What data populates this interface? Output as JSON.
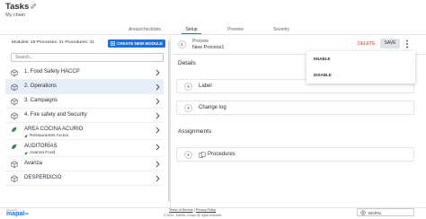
{
  "header": {
    "title": "Tasks",
    "subtitle": "My chain"
  },
  "tabs": [
    {
      "label": "Areas/checklists",
      "active": false
    },
    {
      "label": "Setup",
      "active": true
    },
    {
      "label": "Preview",
      "active": false
    },
    {
      "label": "Severity",
      "active": false
    }
  ],
  "left_panel": {
    "counts": "Modules: 18 Processes: 41 Procedures: 41",
    "new_module_label": "CREATE NEW MODULE",
    "search_placeholder": "Search...",
    "modules": [
      {
        "label": "1. Food Safety HACCP",
        "icon": "box-icon",
        "selected": false
      },
      {
        "label": "2. Operations",
        "icon": "box-icon",
        "selected": true
      },
      {
        "label": "3. Campaigns",
        "icon": "box-icon",
        "selected": false
      },
      {
        "label": "4. Fire safety and Security",
        "icon": "box-icon",
        "selected": false
      },
      {
        "label": "AREA COCINA ACURIO",
        "icon": "leaf-icon",
        "sub": "Restaurantes Acurio",
        "selected": false
      },
      {
        "label": "AUDITORÍAS",
        "icon": "leaf-icon",
        "sub": "Avanza Food",
        "selected": false
      },
      {
        "label": "Avanza",
        "icon": "box-icon",
        "selected": false
      },
      {
        "label": "DESPERDICIO",
        "icon": "box-icon",
        "selected": false
      }
    ]
  },
  "process": {
    "key_label": "Process",
    "name": "New Process1",
    "delete_label": "DELETE",
    "save_label": "SAVE"
  },
  "details": {
    "title": "Details",
    "items": [
      "Label",
      "Change log"
    ]
  },
  "assignments": {
    "title": "Assignments",
    "items": [
      "Procedures"
    ]
  },
  "context_menu": {
    "items": [
      "ENABLE",
      "DISABLE"
    ]
  },
  "footer": {
    "powered_by": "powered by",
    "brand": "mapal",
    "brand_suffix": "os",
    "terms": "Terms of Service",
    "separator": "|",
    "privacy": "Privacy Policy",
    "copyright": "© 2024 - MAPAL Group. All rights reserved",
    "org_name": "MAPAL"
  },
  "colors": {
    "accent": "#1c6fe0",
    "danger": "#d9382b",
    "selected_row": "#e6eef8"
  }
}
